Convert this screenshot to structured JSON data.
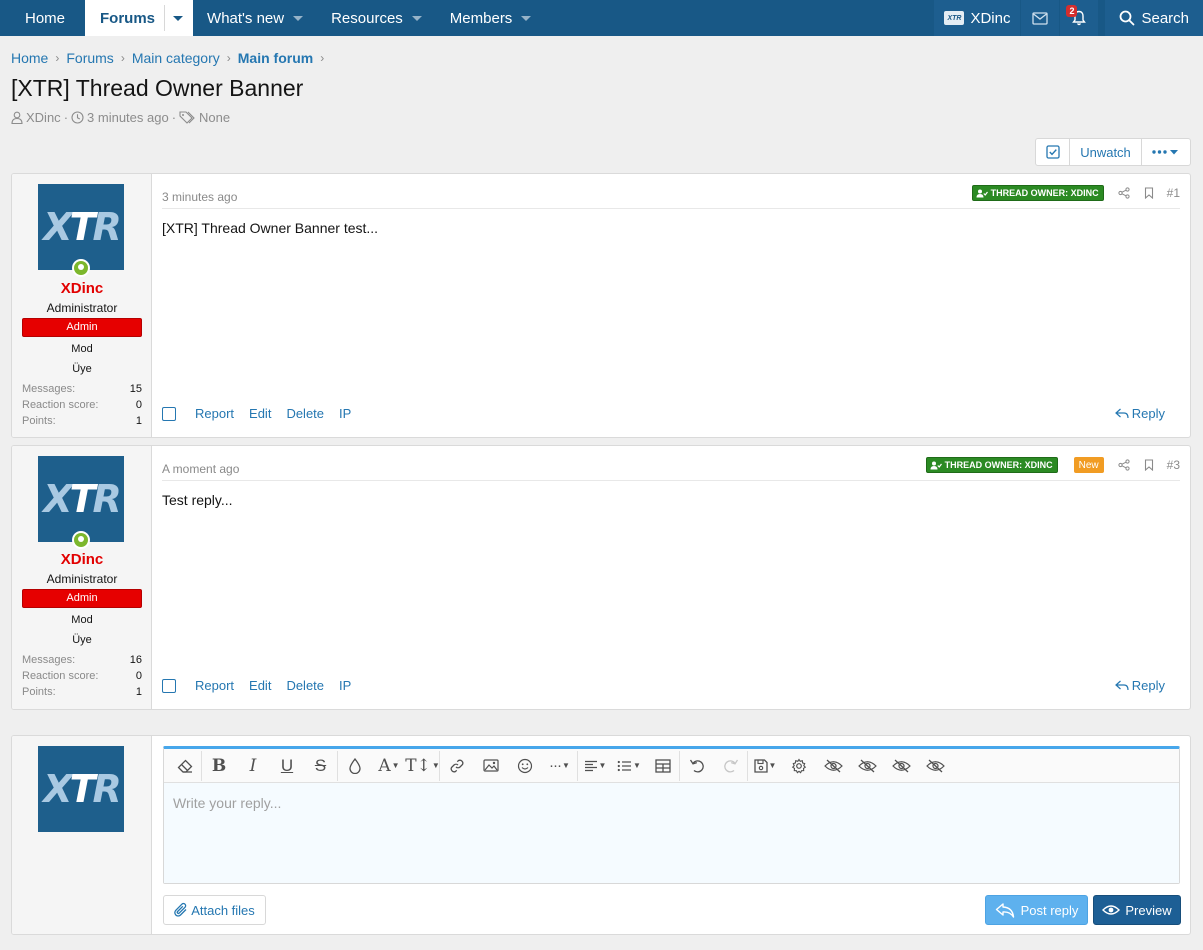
{
  "nav": {
    "tabs": [
      {
        "label": "Home"
      },
      {
        "label": "Forums"
      },
      {
        "label": "What's new"
      },
      {
        "label": "Resources"
      },
      {
        "label": "Members"
      }
    ],
    "user": "XDinc",
    "user_logo": "XTR",
    "alerts_count": "2",
    "search_label": "Search"
  },
  "breadcrumb": [
    "Home",
    "Forums",
    "Main category",
    "Main forum"
  ],
  "thread": {
    "title": "[XTR] Thread Owner Banner",
    "author": "XDinc",
    "time": "3 minutes ago",
    "tags": "None"
  },
  "watch": {
    "unwatch_label": "Unwatch"
  },
  "posts": [
    {
      "username": "XDinc",
      "user_title": "Administrator",
      "banner": "Admin",
      "groups": [
        "Mod",
        "Üye"
      ],
      "stats": [
        {
          "label": "Messages:",
          "value": "15"
        },
        {
          "label": "Reaction score:",
          "value": "0"
        },
        {
          "label": "Points:",
          "value": "1"
        }
      ],
      "time": "3 minutes ago",
      "owner_badge": "THREAD OWNER: XDINC",
      "number": "#1",
      "body": "[XTR] Thread Owner Banner test...",
      "actions": [
        "Report",
        "Edit",
        "Delete",
        "IP"
      ],
      "reply_label": "Reply"
    },
    {
      "username": "XDinc",
      "user_title": "Administrator",
      "banner": "Admin",
      "groups": [
        "Mod",
        "Üye"
      ],
      "stats": [
        {
          "label": "Messages:",
          "value": "16"
        },
        {
          "label": "Reaction score:",
          "value": "0"
        },
        {
          "label": "Points:",
          "value": "1"
        }
      ],
      "time": "A moment ago",
      "owner_badge": "THREAD OWNER: XDINC",
      "new_badge": "New",
      "number": "#3",
      "body": "Test reply...",
      "actions": [
        "Report",
        "Edit",
        "Delete",
        "IP"
      ],
      "reply_label": "Reply"
    }
  ],
  "editor": {
    "placeholder": "Write your reply...",
    "attach_label": "Attach files",
    "post_reply_label": "Post reply",
    "preview_label": "Preview"
  },
  "avatar_text": {
    "a": "X",
    "b": "T",
    "c": "R"
  },
  "colors": {
    "nav": "#185886",
    "username": "#e20000",
    "admin_banner": "#e60000",
    "owner_badge": "#2b8a23",
    "new_badge": "#f19c23"
  }
}
